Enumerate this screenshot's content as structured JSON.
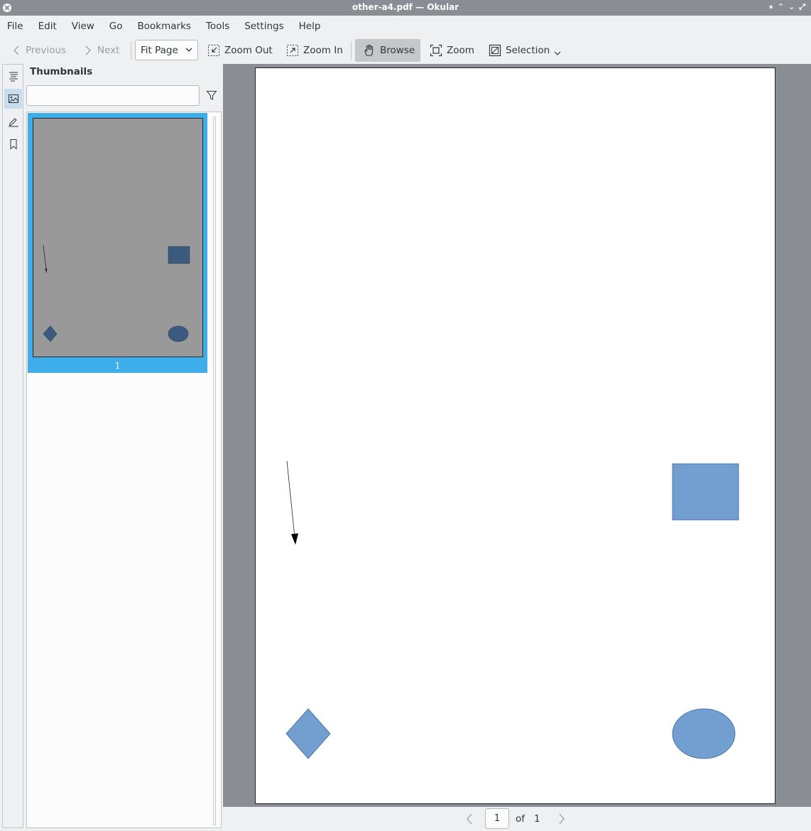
{
  "window": {
    "title": "other-a4.pdf — Okular",
    "wm_buttons": [
      "⭑",
      "⌃",
      "⌄",
      "⤢"
    ]
  },
  "menu": [
    "File",
    "Edit",
    "View",
    "Go",
    "Bookmarks",
    "Tools",
    "Settings",
    "Help"
  ],
  "toolbar": {
    "previous_label": "Previous",
    "next_label": "Next",
    "zoom_value": "Fit Page",
    "zoom_out_label": "Zoom Out",
    "zoom_in_label": "Zoom In",
    "browse_label": "Browse",
    "zoom_label": "Zoom",
    "selection_label": "Selection"
  },
  "sidebar": {
    "panel_title": "Thumbnails",
    "search_value": "",
    "thumbnails": [
      {
        "page_label": "1"
      }
    ]
  },
  "document": {
    "page_background": "#ffffff",
    "shape_fill": "#729fcf",
    "shape_stroke": "#3465a4",
    "shapes": [
      "arrow",
      "rectangle",
      "diamond",
      "ellipse"
    ]
  },
  "pagebar": {
    "current_page": "1",
    "of_label": "of",
    "total_pages": "1"
  },
  "colors": {
    "accent": "#3daee9",
    "viewer_background": "#8a8e94"
  }
}
